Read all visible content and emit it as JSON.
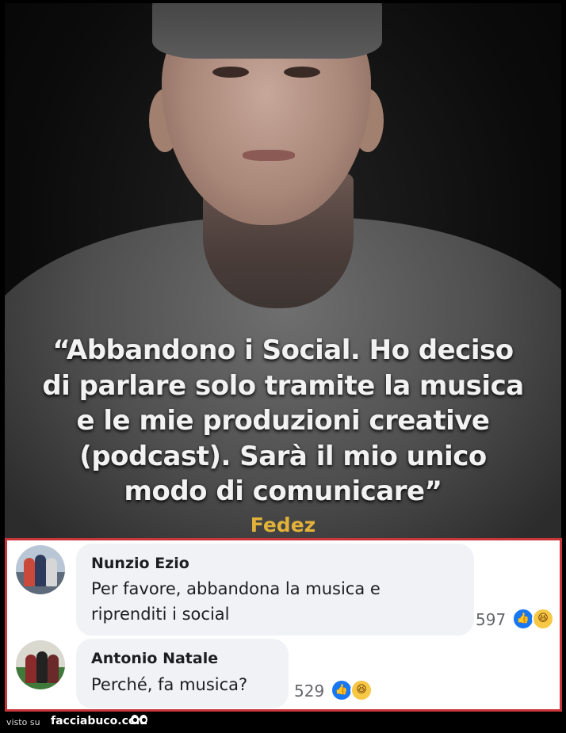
{
  "post": {
    "quote_lines": [
      "“Abbandono i Social. Ho deciso",
      "di parlare solo tramite la musica",
      "e le mie produzioni creative",
      "(podcast). Sarà il mio unico",
      "modo di comunicare”"
    ],
    "author": "Fedez"
  },
  "comments": [
    {
      "name": "Nunzio Ezio",
      "text_lines": [
        "Per favore, abbandona la musica e",
        "riprenditi i social"
      ],
      "reaction_count": "597",
      "reactions": [
        "like-icon",
        "haha-icon"
      ]
    },
    {
      "name": "Antonio Natale",
      "text_lines": [
        "Perché, fa musica?"
      ],
      "reaction_count": "529",
      "reactions": [
        "like-icon",
        "haha-icon"
      ]
    }
  ],
  "footer": {
    "prefix": "visto su",
    "site": "facciabuco.com"
  },
  "colors": {
    "author": "#e2b23a",
    "border": "#c9363a",
    "like": "#1877f2",
    "haha": "#f7c845",
    "bubble": "#f0f2f5"
  }
}
